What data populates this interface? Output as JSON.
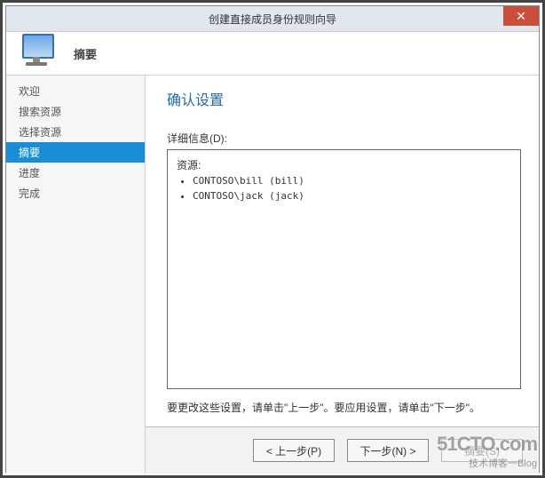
{
  "window": {
    "title": "创建直接成员身份规则向导",
    "close_glyph": "✕"
  },
  "banner": {
    "section_title": "摘要"
  },
  "sidebar": {
    "items": [
      {
        "label": "欢迎",
        "active": false
      },
      {
        "label": "搜索资源",
        "active": false
      },
      {
        "label": "选择资源",
        "active": false
      },
      {
        "label": "摘要",
        "active": true
      },
      {
        "label": "进度",
        "active": false
      },
      {
        "label": "完成",
        "active": false
      }
    ]
  },
  "content": {
    "heading": "确认设置",
    "details_label": "详细信息(D):",
    "details_caption": "资源:",
    "resources": [
      "CONTOSO\\bill (bill)",
      "CONTOSO\\jack (jack)"
    ],
    "hint": "要更改这些设置，请单击\"上一步\"。要应用设置，请单击\"下一步\"。"
  },
  "buttons": {
    "prev": "< 上一步(P)",
    "next": "下一步(N) >",
    "summary": "摘要(S)"
  },
  "watermark": {
    "logo": "51CTO.com",
    "sub": "技术博客一Blog"
  }
}
